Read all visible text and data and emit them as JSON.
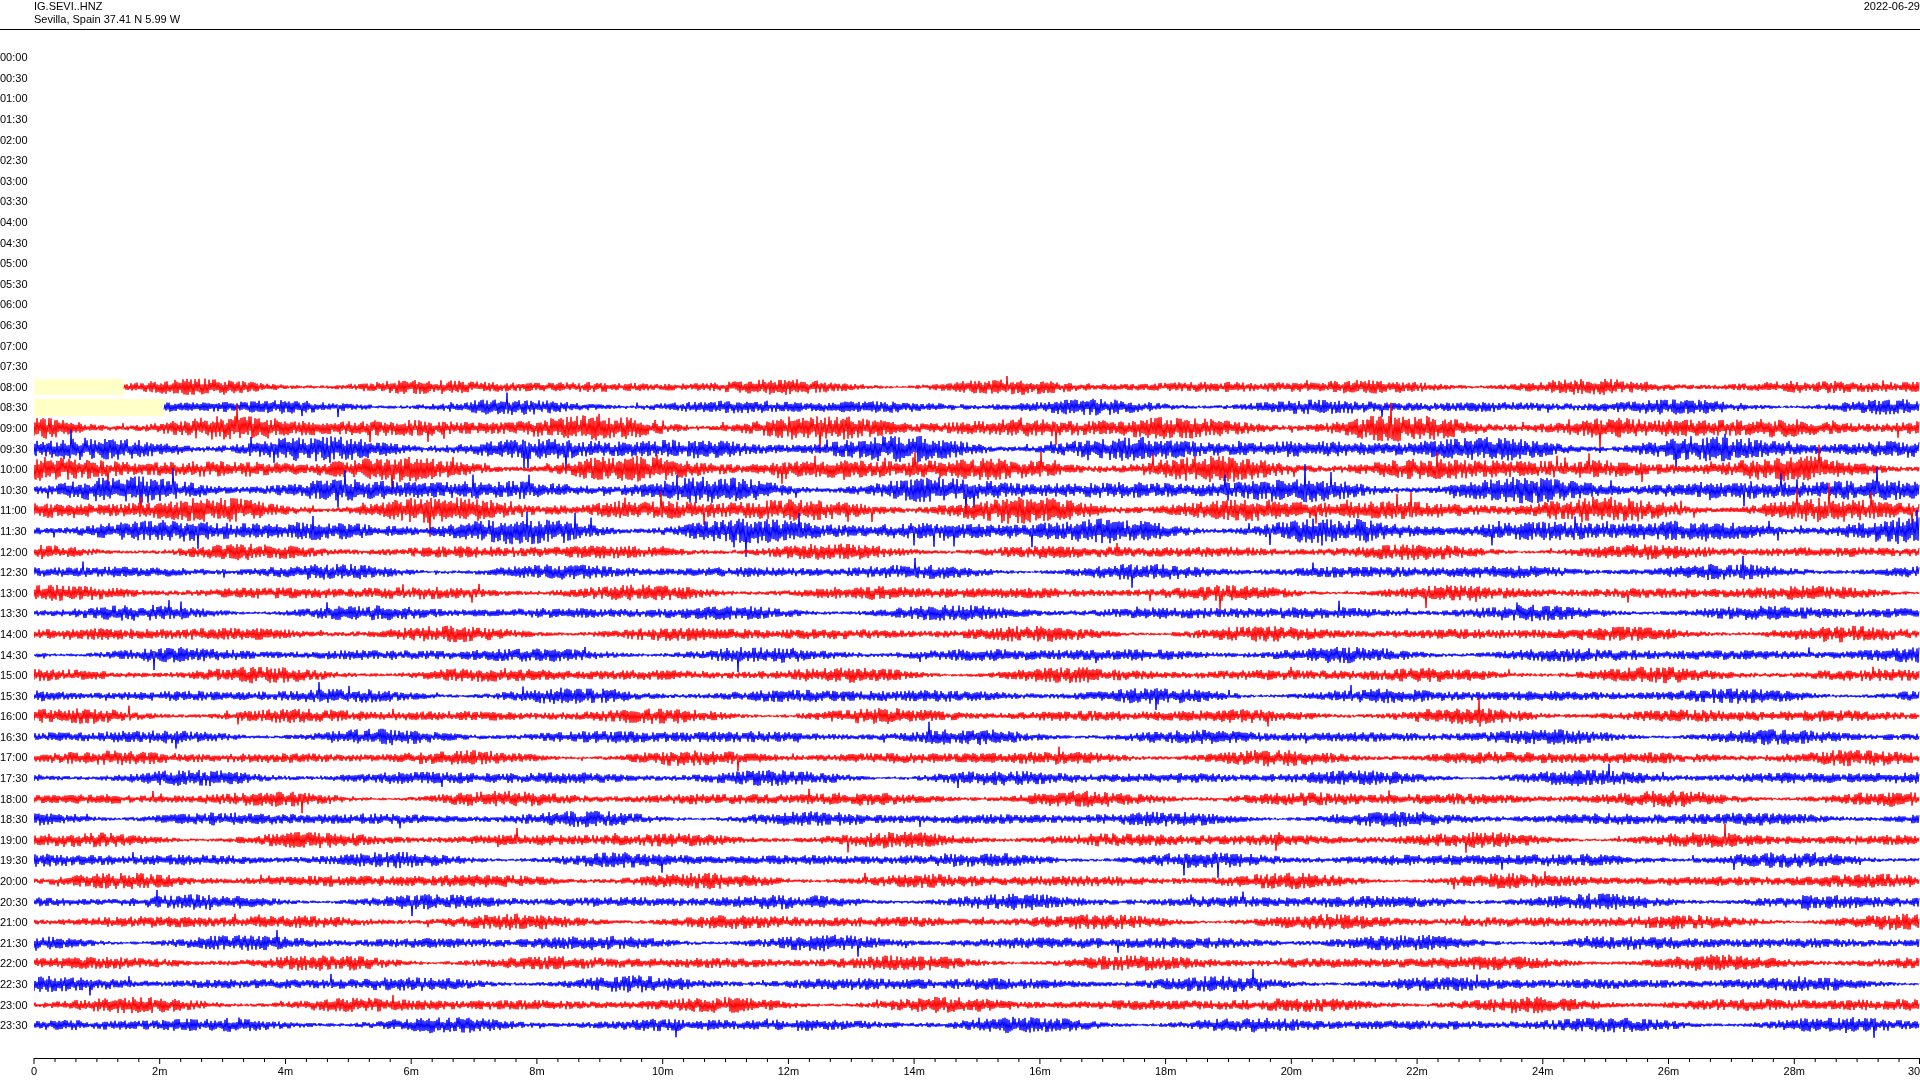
{
  "header": {
    "station": "IG.SEVI..HNZ",
    "location": "Sevilla, Spain  37.41 N 5.99 W",
    "date": "2022-06-29"
  },
  "rows": [
    {
      "time": "00:00",
      "kind": "empty",
      "gap": false
    },
    {
      "time": "00:30",
      "kind": "empty",
      "gap": false
    },
    {
      "time": "01:00",
      "kind": "empty",
      "gap": false
    },
    {
      "time": "01:30",
      "kind": "empty",
      "gap": false
    },
    {
      "time": "02:00",
      "kind": "empty",
      "gap": false
    },
    {
      "time": "02:30",
      "kind": "empty",
      "gap": false
    },
    {
      "time": "03:00",
      "kind": "empty",
      "gap": false
    },
    {
      "time": "03:30",
      "kind": "empty",
      "gap": false
    },
    {
      "time": "04:00",
      "kind": "empty",
      "gap": false
    },
    {
      "time": "04:30",
      "kind": "empty",
      "gap": false
    },
    {
      "time": "05:00",
      "kind": "empty",
      "gap": false
    },
    {
      "time": "05:30",
      "kind": "empty",
      "gap": false
    },
    {
      "time": "06:00",
      "kind": "empty",
      "gap": false
    },
    {
      "time": "06:30",
      "kind": "empty",
      "gap": false
    },
    {
      "time": "07:00",
      "kind": "empty",
      "gap": false
    },
    {
      "time": "07:30",
      "kind": "empty",
      "gap": false
    },
    {
      "time": "08:00",
      "color": "#ff0000",
      "kind": "trace",
      "gap": true
    },
    {
      "time": "08:30",
      "color": "#0000ff",
      "kind": "trace",
      "gap": true
    },
    {
      "time": "09:00",
      "color": "#ff0000",
      "kind": "busy",
      "gap": false
    },
    {
      "time": "09:30",
      "color": "#0000ff",
      "kind": "busy",
      "gap": false
    },
    {
      "time": "10:00",
      "color": "#ff0000",
      "kind": "busy",
      "gap": false
    },
    {
      "time": "10:30",
      "color": "#0000ff",
      "kind": "busy",
      "gap": false
    },
    {
      "time": "11:00",
      "color": "#ff0000",
      "kind": "busy",
      "gap": false
    },
    {
      "time": "11:30",
      "color": "#0000ff",
      "kind": "busy",
      "gap": false
    },
    {
      "time": "12:00",
      "color": "#ff0000",
      "kind": "trace",
      "gap": false
    },
    {
      "time": "12:30",
      "color": "#0000ff",
      "kind": "trace",
      "gap": false
    },
    {
      "time": "13:00",
      "color": "#ff0000",
      "kind": "trace",
      "gap": false
    },
    {
      "time": "13:30",
      "color": "#0000ff",
      "kind": "trace",
      "gap": false
    },
    {
      "time": "14:00",
      "color": "#ff0000",
      "kind": "trace",
      "gap": false
    },
    {
      "time": "14:30",
      "color": "#0000ff",
      "kind": "trace",
      "gap": false
    },
    {
      "time": "15:00",
      "color": "#ff0000",
      "kind": "trace",
      "gap": false
    },
    {
      "time": "15:30",
      "color": "#0000ff",
      "kind": "trace",
      "gap": false
    },
    {
      "time": "16:00",
      "color": "#ff0000",
      "kind": "trace",
      "gap": false
    },
    {
      "time": "16:30",
      "color": "#0000ff",
      "kind": "trace",
      "gap": false
    },
    {
      "time": "17:00",
      "color": "#ff0000",
      "kind": "trace",
      "gap": false
    },
    {
      "time": "17:30",
      "color": "#0000ff",
      "kind": "trace",
      "gap": false
    },
    {
      "time": "18:00",
      "color": "#ff0000",
      "kind": "trace",
      "gap": false
    },
    {
      "time": "18:30",
      "color": "#0000ff",
      "kind": "trace",
      "gap": false
    },
    {
      "time": "19:00",
      "color": "#ff0000",
      "kind": "trace",
      "gap": false
    },
    {
      "time": "19:30",
      "color": "#0000ff",
      "kind": "trace",
      "gap": false
    },
    {
      "time": "20:00",
      "color": "#ff0000",
      "kind": "trace",
      "gap": false
    },
    {
      "time": "20:30",
      "color": "#0000ff",
      "kind": "trace",
      "gap": false
    },
    {
      "time": "21:00",
      "color": "#ff0000",
      "kind": "trace",
      "gap": false
    },
    {
      "time": "21:30",
      "color": "#0000ff",
      "kind": "trace",
      "gap": false
    },
    {
      "time": "22:00",
      "color": "#ff0000",
      "kind": "trace",
      "gap": false
    },
    {
      "time": "22:30",
      "color": "#0000ff",
      "kind": "trace",
      "gap": false
    },
    {
      "time": "23:00",
      "color": "#ff0000",
      "kind": "trace",
      "gap": false
    },
    {
      "time": "23:30",
      "color": "#0000ff",
      "kind": "trace",
      "gap": false
    }
  ],
  "x_ticks": [
    "0",
    "2m",
    "4m",
    "6m",
    "8m",
    "10m",
    "12m",
    "14m",
    "16m",
    "18m",
    "20m",
    "22m",
    "24m",
    "26m",
    "28m",
    "30"
  ]
}
